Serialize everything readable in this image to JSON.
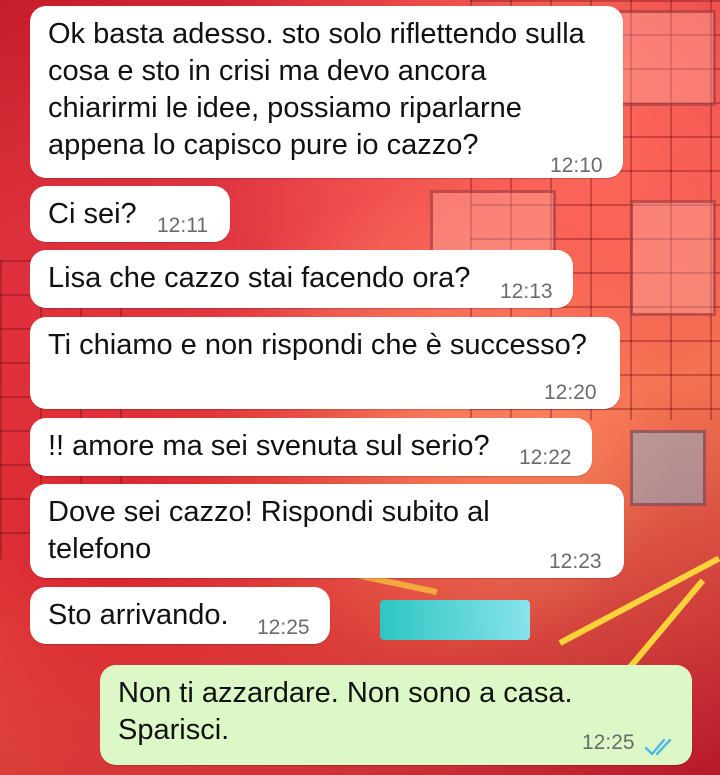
{
  "chat": {
    "messages": [
      {
        "direction": "in",
        "text": "Ok basta adesso. sto solo riflettendo sulla\ncosa e sto in crisi ma devo ancora\nchiarirmi le idee, possiamo riparlarne\nappena lo capisco pure io cazzo?",
        "time": "12:10"
      },
      {
        "direction": "in",
        "text": "Ci sei?",
        "time": "12:11"
      },
      {
        "direction": "in",
        "text": "Lisa che cazzo stai facendo ora?",
        "time": "12:13"
      },
      {
        "direction": "in",
        "text": "Ti chiamo e non rispondi che è successo?",
        "time": "12:20"
      },
      {
        "direction": "in",
        "text": "!! amore ma sei svenuta sul serio?",
        "time": "12:22"
      },
      {
        "direction": "in",
        "text": "Dove sei cazzo! Rispondi subito al\ntelefono",
        "time": "12:23"
      },
      {
        "direction": "in",
        "text": "Sto arrivando.",
        "time": "12:25"
      },
      {
        "direction": "out",
        "text": "Non ti azzardare. Non sono a casa.\nSparisci.",
        "time": "12:25",
        "status": "read"
      }
    ]
  },
  "colors": {
    "incoming_bubble": "#ffffff",
    "outgoing_bubble": "#dcf8c6",
    "read_ticks": "#4fb6ec",
    "timestamp": "#6b6b6b"
  },
  "icons": {
    "read_status": "double-check-icon"
  }
}
